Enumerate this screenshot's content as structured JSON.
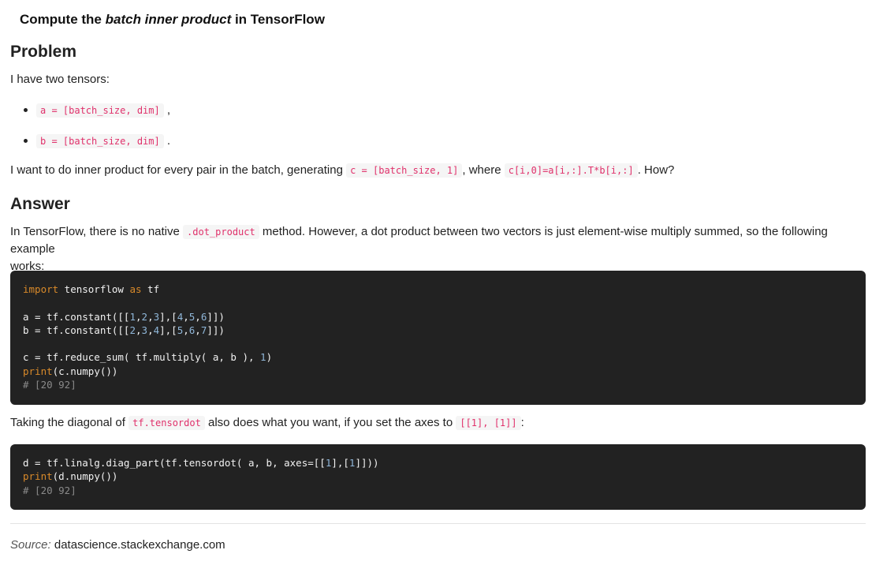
{
  "title": {
    "prefix": "Compute the ",
    "emphasis": "batch inner product",
    "suffix": " in TensorFlow"
  },
  "problem": {
    "heading": "Problem",
    "intro": "I have two tensors:",
    "bullets": [
      {
        "code": "a = [batch_size, dim]",
        "trail": ","
      },
      {
        "code": "b = [batch_size, dim]",
        "trail": "."
      }
    ],
    "question": {
      "t1": "I want to do inner product for every pair in the batch, generating ",
      "c1": "c = [batch_size, 1]",
      "t2": ", where ",
      "c2": "c[i,0]=a[i,:].T*b[i,:]",
      "t3": ". How?"
    }
  },
  "answer": {
    "heading": "Answer",
    "para1": {
      "t1": "In TensorFlow, there is no native ",
      "c1": ".dot_product",
      "t2": " method. However, a dot product between two vectors is just element-wise multiply summed, so the following example",
      "t3": "works:"
    },
    "code1": {
      "l1_kw": "import",
      "l1_mid": " tensorflow ",
      "l1_kw2": "as",
      "l1_end": " tf",
      "l2_a": "a = tf.constant([[",
      "l2_n1": "1",
      "l2_n2": "2",
      "l2_n3": "3",
      "l2_n4": "4",
      "l2_n5": "5",
      "l2_n6": "6",
      "l3_a": "b = tf.constant([[",
      "l3_n1": "2",
      "l3_n2": "3",
      "l3_n3": "4",
      "l3_n4": "5",
      "l3_n5": "6",
      "l3_n6": "7",
      "l4_a": "c = tf.reduce_sum( tf.multiply( a, b ), ",
      "l4_n": "1",
      "l4_end": ")",
      "l5_kw": "print",
      "l5_end": "(c.numpy())",
      "l6_cm": "# [20 92]"
    },
    "para2": {
      "t1": "Taking the diagonal of ",
      "c1": "tf.tensordot",
      "t2": " also does what you want, if you set the axes to ",
      "c2": "[[1], [1]]",
      "t3": ":"
    },
    "code2": {
      "l1_a": "d = tf.linalg.diag_part(tf.tensordot( a, b, axes=[[",
      "l1_n1": "1",
      "l1_mid": "],[",
      "l1_n2": "1",
      "l1_end": "]]))",
      "l2_kw": "print",
      "l2_end": "(d.numpy())",
      "l3_cm": "# [20 92]"
    }
  },
  "source": {
    "label": "Source:",
    "site": "datascience.stackexchange.com"
  }
}
